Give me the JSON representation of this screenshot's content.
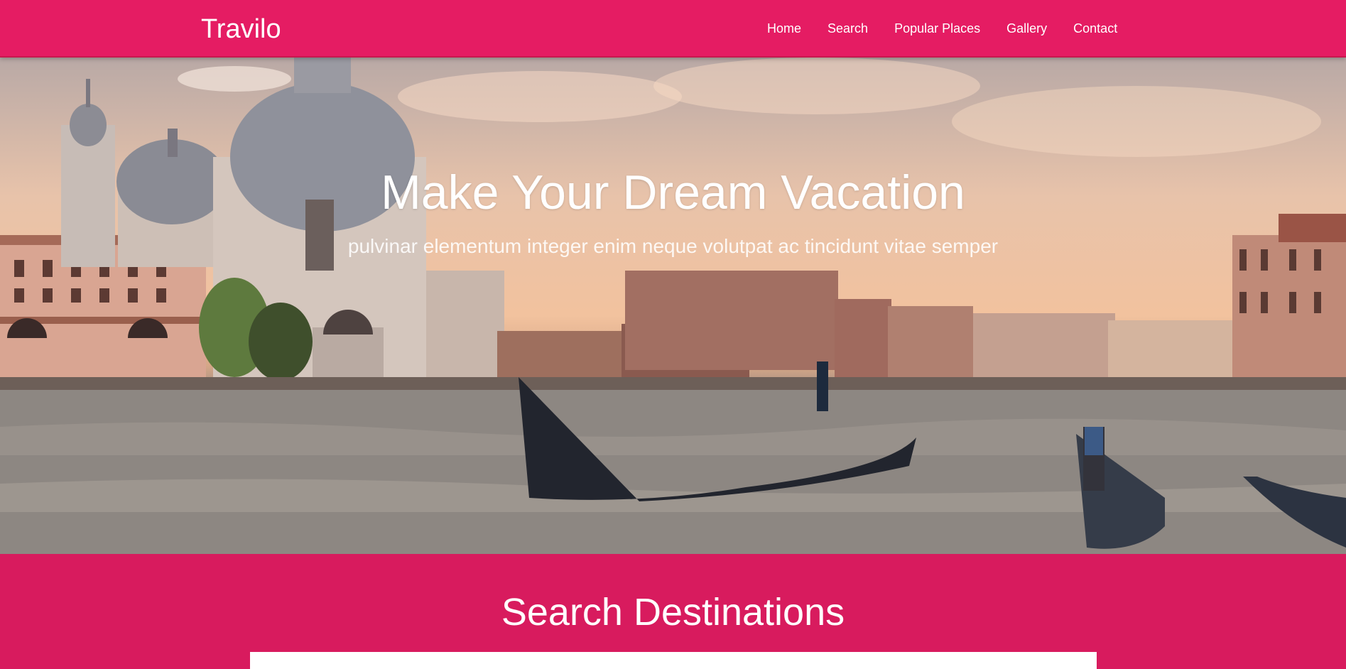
{
  "navbar": {
    "brand": "Travilo",
    "links": [
      {
        "label": "Home"
      },
      {
        "label": "Search"
      },
      {
        "label": "Popular Places"
      },
      {
        "label": "Gallery"
      },
      {
        "label": "Contact"
      }
    ],
    "background_color": "#e51c63"
  },
  "hero": {
    "title": "Make Your Dream Vacation",
    "subtitle": "pulvinar elementum integer enim neque volutpat ac tincidunt vitae semper"
  },
  "search_section": {
    "title": "Search Destinations",
    "background_color": "#d81b5e"
  }
}
